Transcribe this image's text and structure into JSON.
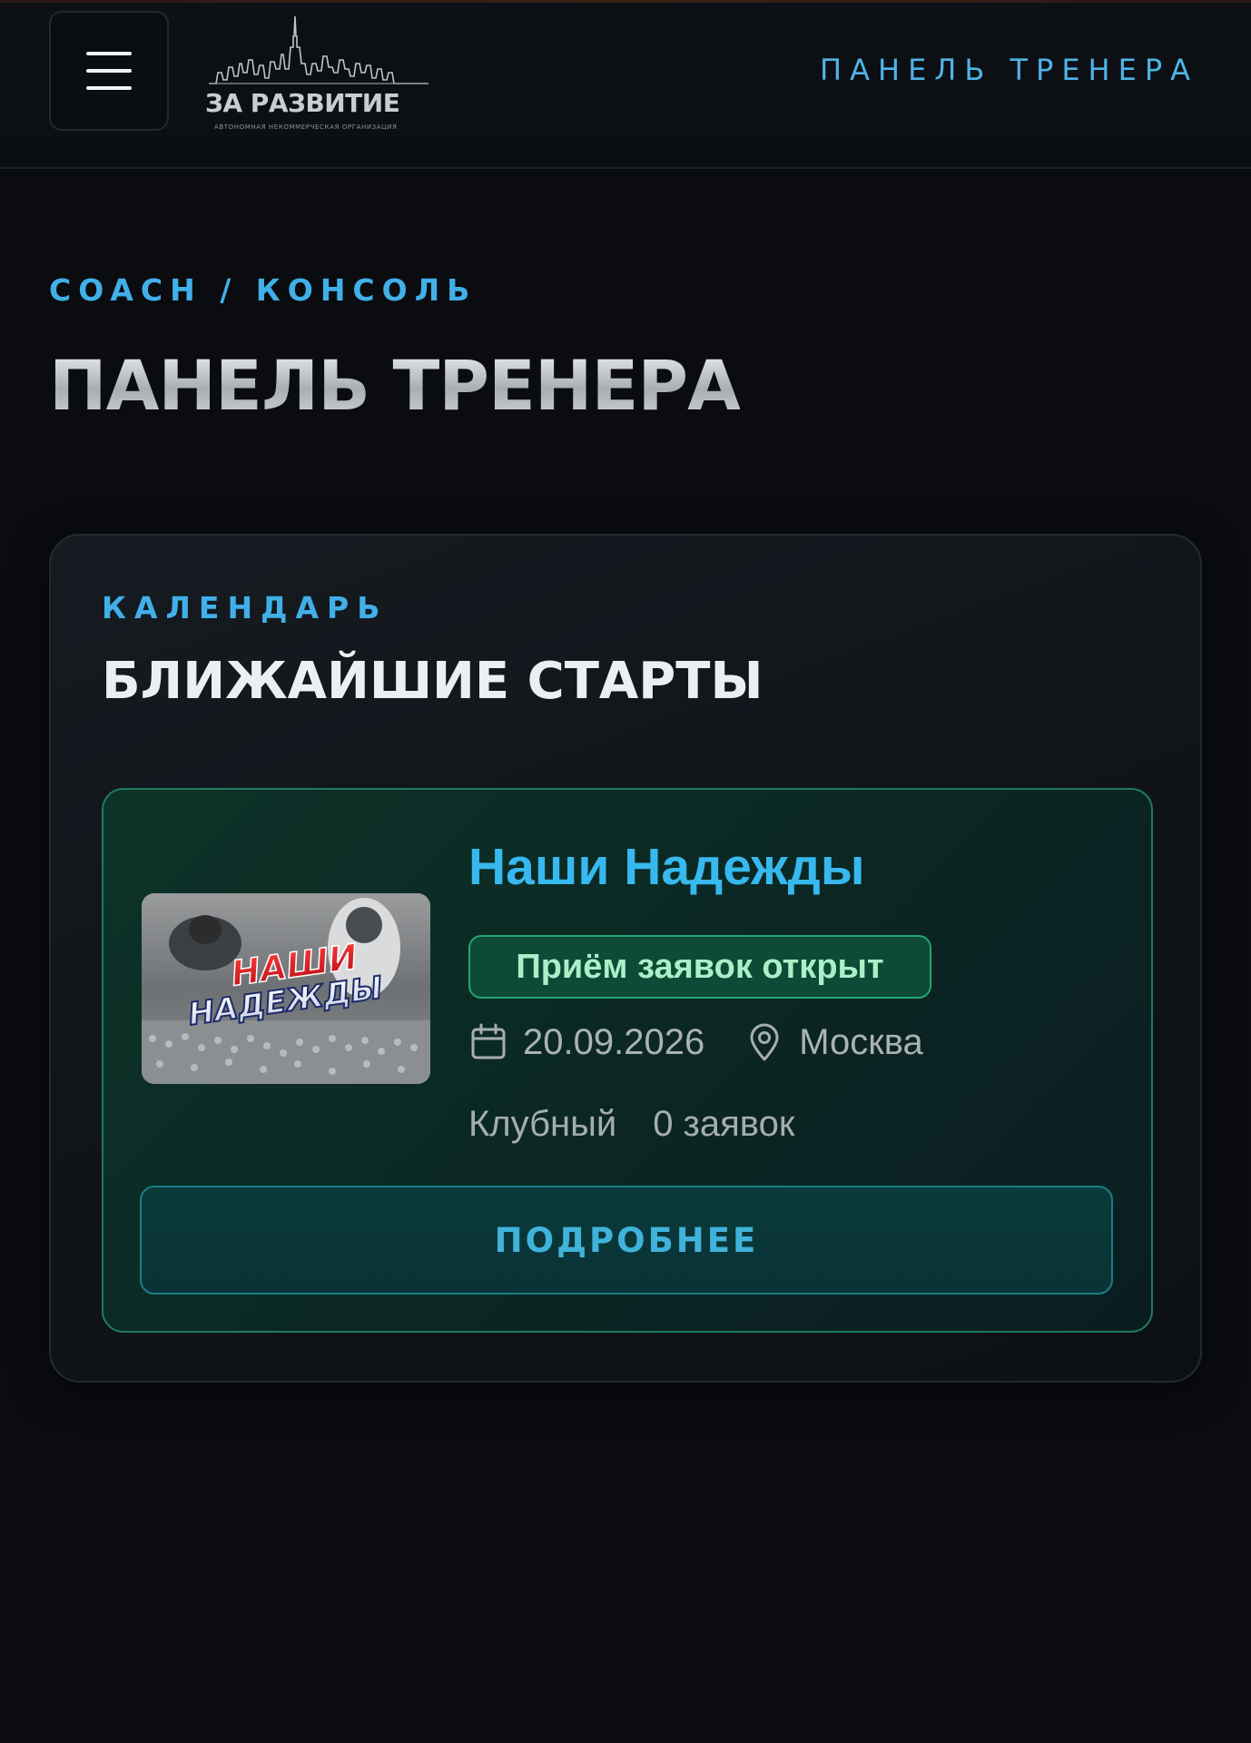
{
  "header": {
    "logo_text": "ЗА РАЗВИТИЕ",
    "logo_subtitle": "АВТОНОМНАЯ НЕКОММЕРЧЕСКАЯ ОРГАНИЗАЦИЯ",
    "nav_link": "ПАНЕЛЬ ТРЕНЕРА",
    "menu_icon": "hamburger-icon"
  },
  "page": {
    "breadcrumb": "COACH / КОНСОЛЬ",
    "title": "ПАНЕЛЬ ТРЕНЕРА"
  },
  "calendar_card": {
    "kicker": "КАЛЕНДАРЬ",
    "title": "БЛИЖАЙШИЕ СТАРТЫ",
    "events": [
      {
        "name": "Наши Надежды",
        "thumbnail_text_line1": "НАШИ",
        "thumbnail_text_line2": "НАДЕЖДЫ",
        "status": "Приём заявок открыт",
        "date_icon": "calendar-icon",
        "date": "20.09.2026",
        "location_icon": "location-pin-icon",
        "location": "Москва",
        "type": "Клубный",
        "applications": "0 заявок",
        "button_label": "ПОДРОБНЕЕ"
      }
    ]
  },
  "colors": {
    "background": "#0a0c10",
    "accent_blue": "#41afe8",
    "status_green": "#23a671",
    "button_teal": "#187f84"
  }
}
